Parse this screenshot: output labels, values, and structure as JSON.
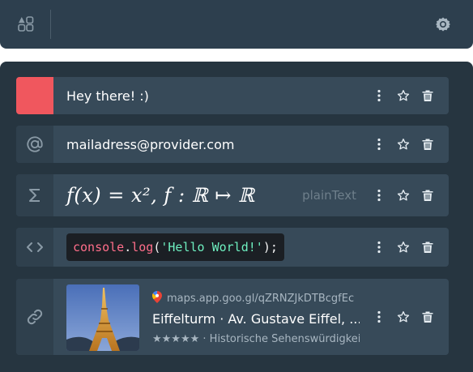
{
  "topbar": {
    "apps_icon": "apps-icon",
    "settings_icon": "settings-gear-icon"
  },
  "clips": [
    {
      "type": "color",
      "color": "#f0575e",
      "text": "Hey there! :)"
    },
    {
      "type": "email",
      "icon": "at-icon",
      "text": "mailadress@provider.com"
    },
    {
      "type": "math",
      "icon": "sigma-icon",
      "formula_text": "f(x) = x², f : ℝ ↦ ℝ",
      "label": "plainText"
    },
    {
      "type": "code",
      "icon": "code-brackets-icon",
      "code": {
        "object": "console",
        "dot": ".",
        "fn": "log",
        "open": "(",
        "string": "'Hello World!'",
        "close": ");"
      }
    },
    {
      "type": "link",
      "icon": "link-icon",
      "url": "maps.app.goo.gl/qZRNZJkDTBcgfEc",
      "title": "Eiffelturm · Av. Gustave Eiffel, ...",
      "subtitle": "★★★★★ · Historische Sehenswürdigkeit"
    }
  ],
  "actions": [
    "more-vertical-icon",
    "star-outline-icon",
    "trash-icon"
  ]
}
